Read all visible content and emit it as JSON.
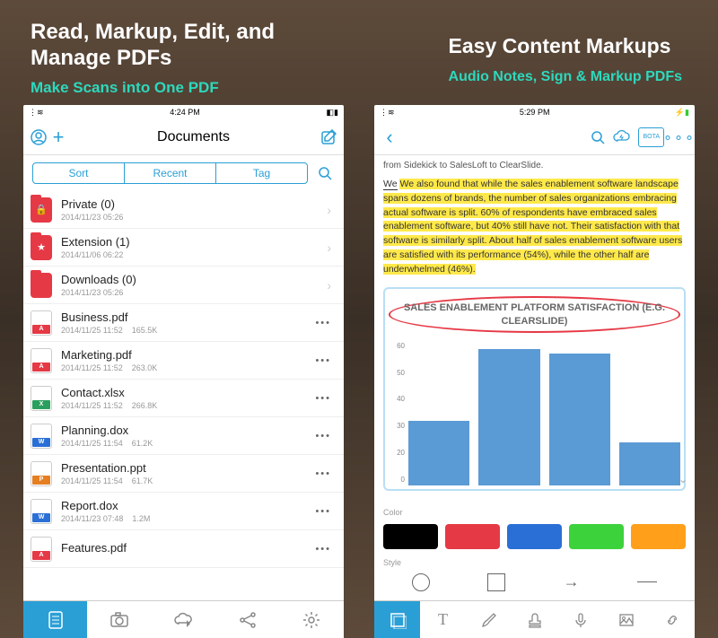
{
  "headings": {
    "left_title": "Read, Markup, Edit, and\nManage PDFs",
    "left_sub": "Make Scans into One PDF",
    "right_title": "Easy Content Markups",
    "right_sub": "Audio Notes, Sign & Markup PDFs"
  },
  "left_phone": {
    "status_time": "4:24 PM",
    "nav_title": "Documents",
    "segments": [
      "Sort",
      "Recent",
      "Tag"
    ],
    "items": [
      {
        "kind": "folder",
        "color": "#e63946",
        "icon": "lock",
        "name": "Private (0)",
        "date": "2014/11/23 05:26",
        "action": "chevron"
      },
      {
        "kind": "folder",
        "color": "#e63946",
        "icon": "star",
        "name": "Extension (1)",
        "date": "2014/11/06 06:22",
        "action": "chevron"
      },
      {
        "kind": "folder",
        "color": "#e63946",
        "icon": "",
        "name": "Downloads (0)",
        "date": "2014/11/23 05:26",
        "action": "chevron"
      },
      {
        "kind": "file",
        "badge": "A",
        "badgecolor": "#e63946",
        "name": "Business.pdf",
        "date": "2014/11/25 11:52",
        "size": "165.5K",
        "action": "dots"
      },
      {
        "kind": "file",
        "badge": "A",
        "badgecolor": "#e63946",
        "name": "Marketing.pdf",
        "date": "2014/11/25 11:52",
        "size": "263.0K",
        "action": "dots"
      },
      {
        "kind": "file",
        "badge": "X",
        "badgecolor": "#2a9f5e",
        "name": "Contact.xlsx",
        "date": "2014/11/25 11:52",
        "size": "266.8K",
        "action": "dots"
      },
      {
        "kind": "file",
        "badge": "W",
        "badgecolor": "#2a6fd6",
        "name": "Planning.dox",
        "date": "2014/11/25 11:54",
        "size": "61.2K",
        "action": "dots"
      },
      {
        "kind": "file",
        "badge": "P",
        "badgecolor": "#e67e22",
        "name": "Presentation.ppt",
        "date": "2014/11/25 11:54",
        "size": "61.7K",
        "action": "dots"
      },
      {
        "kind": "file",
        "badge": "W",
        "badgecolor": "#2a6fd6",
        "name": "Report.dox",
        "date": "2014/11/23 07:48",
        "size": "1.2M",
        "action": "dots"
      },
      {
        "kind": "file",
        "badge": "A",
        "badgecolor": "#e63946",
        "name": "Features.pdf",
        "date": "",
        "size": "",
        "action": "dots"
      }
    ]
  },
  "right_phone": {
    "status_time": "5:29 PM",
    "bota_label": "BOTA",
    "doc_line": "from Sidekick to SalesLoft to ClearSlide.",
    "doc_para": "We also found that while the sales enablement software landscape spans dozens of brands, the number of sales organizations embracing actual software is split. 60% of respondents have embraced sales enablement software, but 40% still have not. Their satisfaction with that software is similarly split. About half of sales enablement software users are satisfied with its performance (54%), while the other half are underwhelmed (46%).",
    "color_label": "Color",
    "style_label": "Style",
    "colors": [
      "#000000",
      "#e63946",
      "#2a6fd6",
      "#3cd23c",
      "#ff9f1a",
      "#ffffff"
    ]
  },
  "chart_data": {
    "type": "bar",
    "title": "SALES ENABLEMENT PLATFORM SATISFACTION (E.G. CLEARSLIDE)",
    "categories": [
      "",
      "",
      "",
      ""
    ],
    "values": [
      27,
      57,
      55,
      18
    ],
    "ylim": [
      0,
      60
    ],
    "yticks": [
      60,
      50,
      40,
      30,
      20,
      0
    ],
    "color": "#5b9bd5"
  }
}
